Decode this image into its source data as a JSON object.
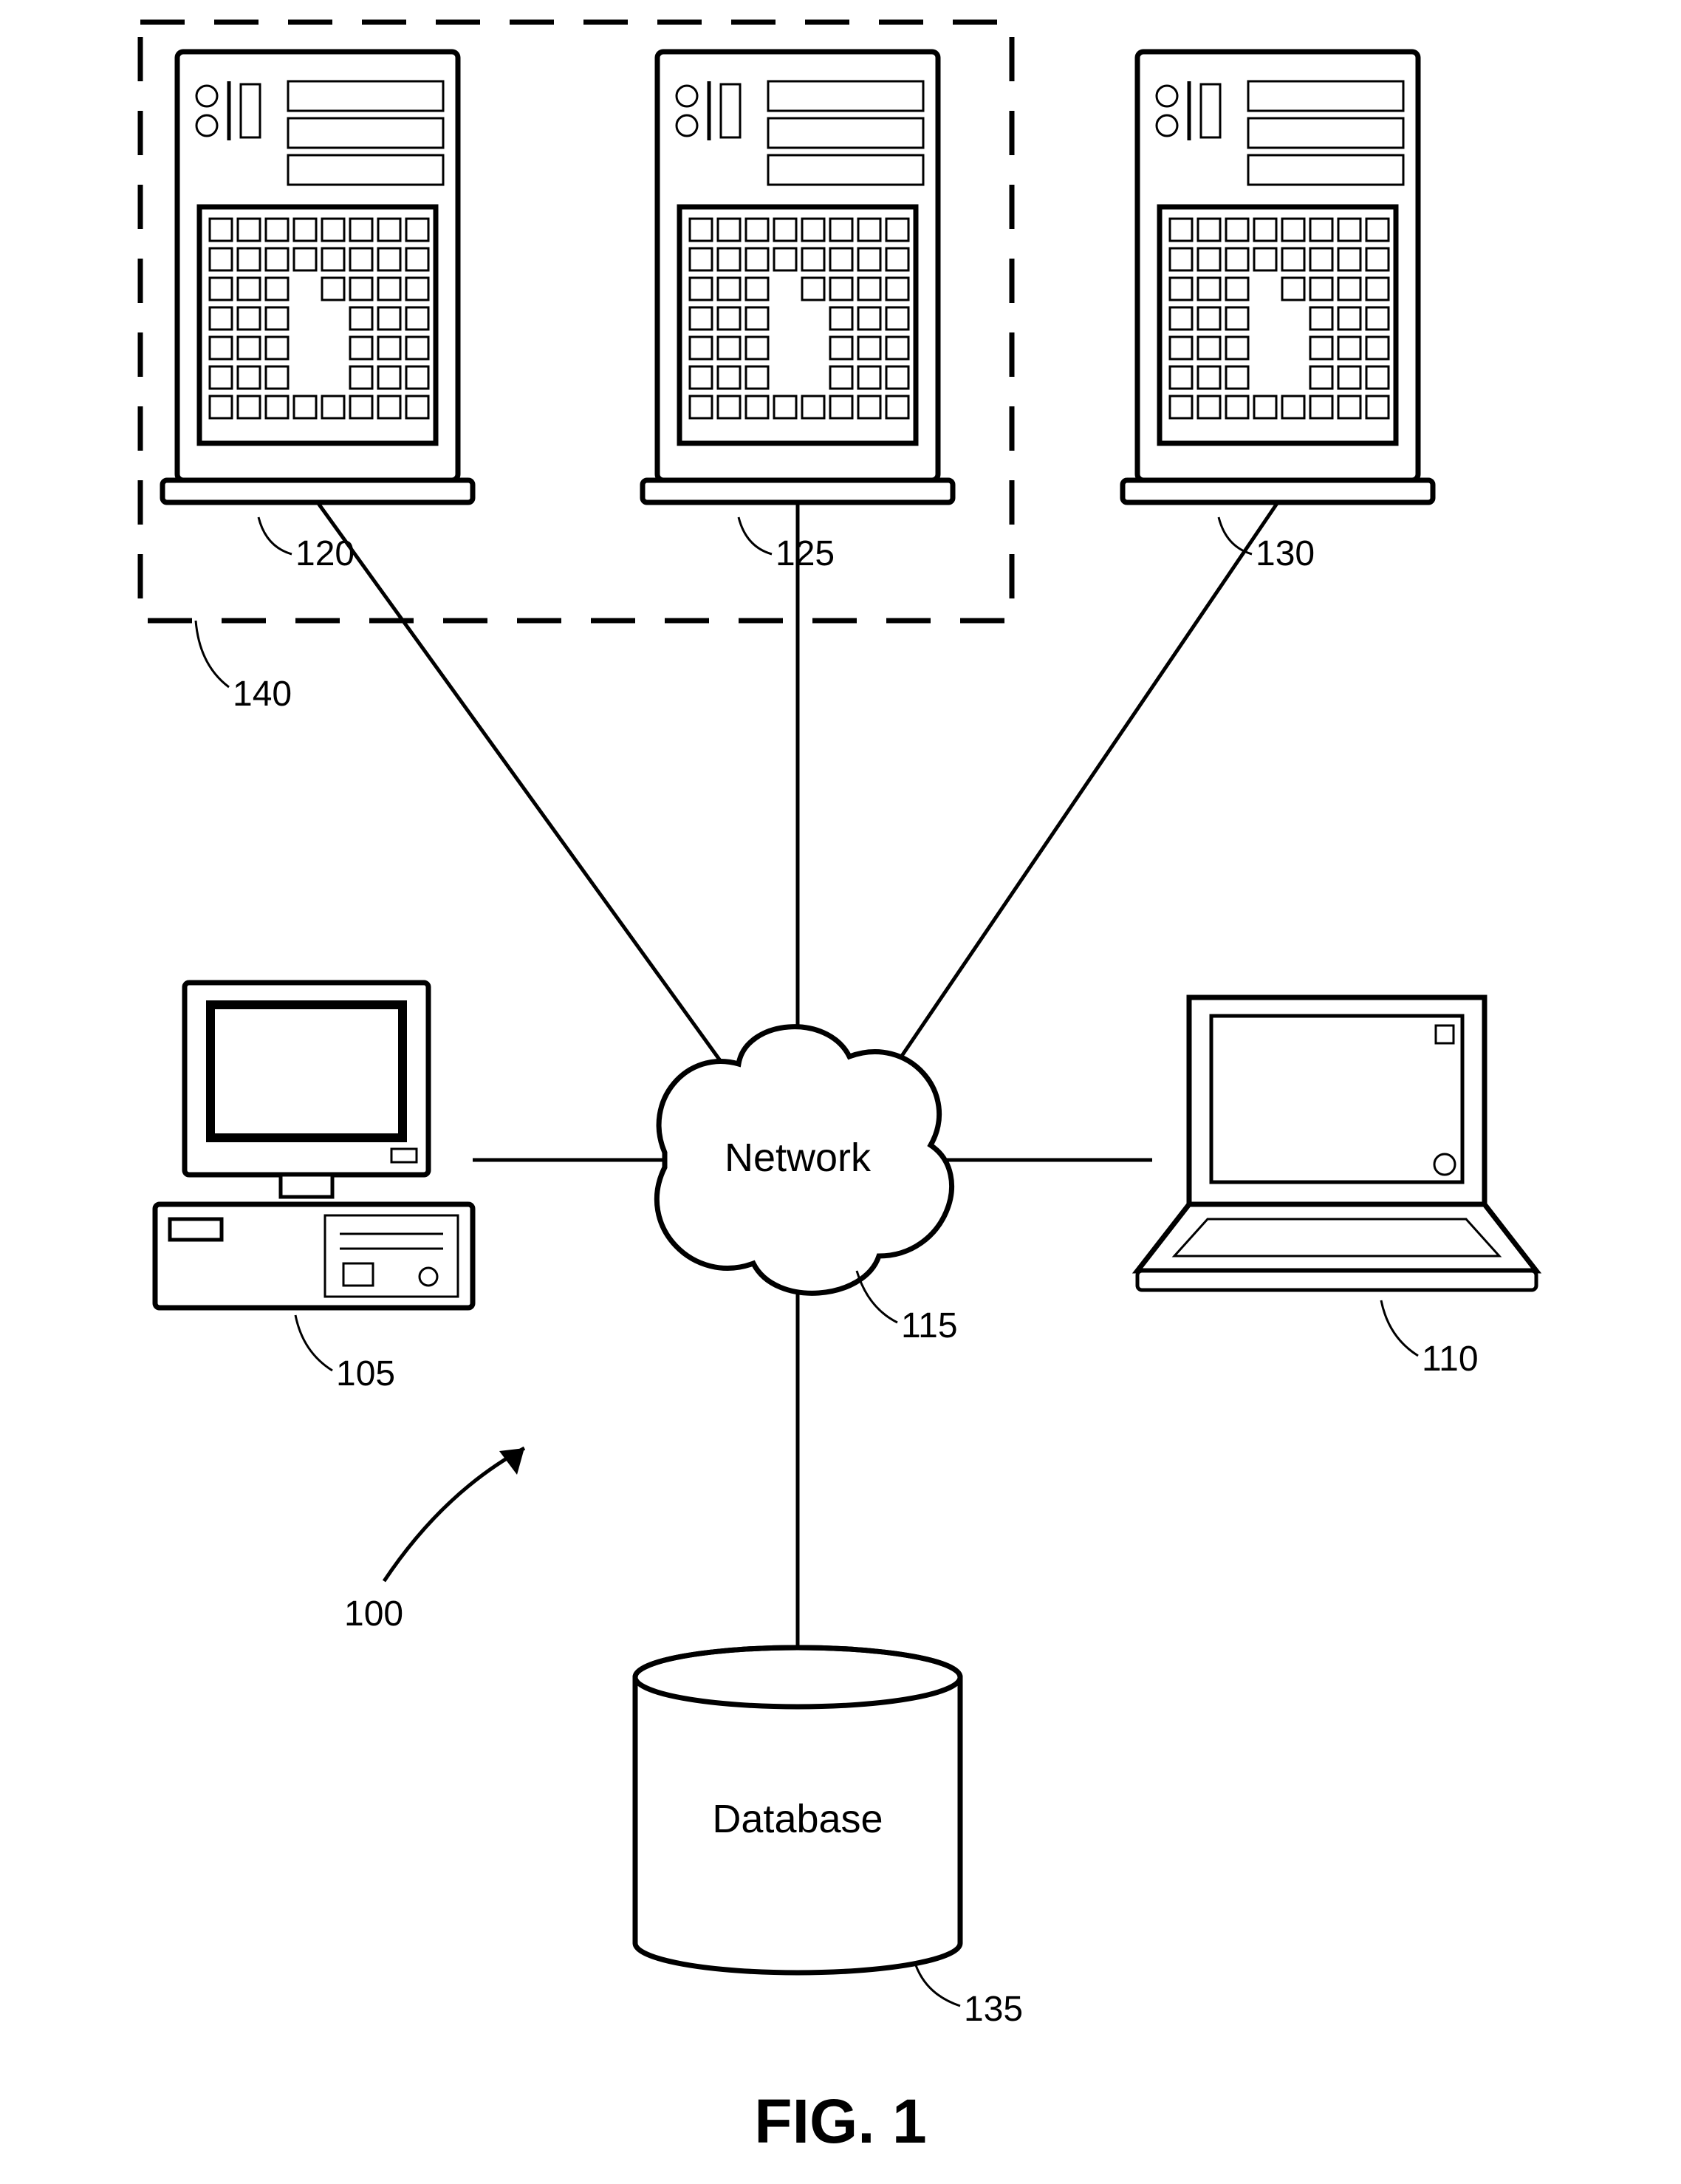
{
  "figure": {
    "caption": "FIG. 1",
    "overall_ref": "100",
    "network_label": "Network",
    "database_label": "Database",
    "refs": {
      "desktop": "105",
      "laptop": "110",
      "network": "115",
      "server_left": "120",
      "server_mid": "125",
      "server_right": "130",
      "database": "135",
      "server_group": "140"
    }
  }
}
